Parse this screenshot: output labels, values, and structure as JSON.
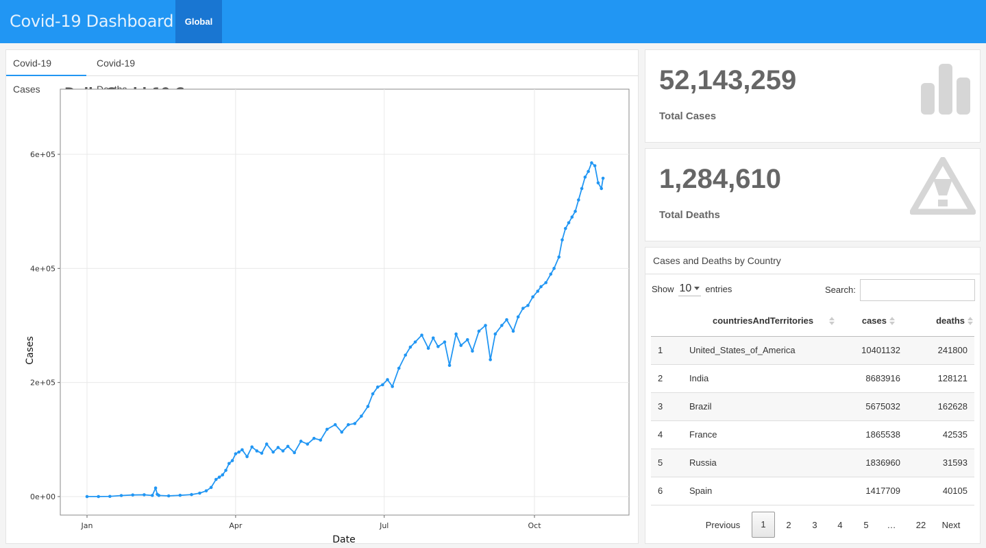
{
  "navbar": {
    "title": "Covid-19 Dashboard",
    "tab_global": "Global"
  },
  "tabs": [
    {
      "label": "Covid-19 Cases"
    },
    {
      "label": "Covid-19 Deaths"
    }
  ],
  "value_boxes": {
    "cases": {
      "value": "52,143,259",
      "label": "Total Cases",
      "icon": "bar-chart-icon"
    },
    "deaths": {
      "value": "1,284,610",
      "label": "Total Deaths",
      "icon": "warning-icon"
    }
  },
  "table_panel": {
    "title": "Cases and Deaths by Country",
    "show_label": "Show",
    "length_value": "10",
    "entries_label": "entries",
    "search_label": "Search:",
    "search_value": "",
    "columns": [
      "",
      "countriesAndTerritories",
      "cases",
      "deaths"
    ],
    "rows": [
      {
        "idx": "1",
        "country": "United_States_of_America",
        "cases": "10401132",
        "deaths": "241800"
      },
      {
        "idx": "2",
        "country": "India",
        "cases": "8683916",
        "deaths": "128121"
      },
      {
        "idx": "3",
        "country": "Brazil",
        "cases": "5675032",
        "deaths": "162628"
      },
      {
        "idx": "4",
        "country": "France",
        "cases": "1865538",
        "deaths": "42535"
      },
      {
        "idx": "5",
        "country": "Russia",
        "cases": "1836960",
        "deaths": "31593"
      },
      {
        "idx": "6",
        "country": "Spain",
        "cases": "1417709",
        "deaths": "40105"
      }
    ],
    "pagination": {
      "previous": "Previous",
      "pages": [
        "1",
        "2",
        "3",
        "4",
        "5",
        "…",
        "22"
      ],
      "current": "1",
      "next": "Next"
    }
  },
  "chart_data": {
    "type": "line",
    "title": "Daily Covid-19 Cases",
    "xlabel": "Date",
    "ylabel": "Cases",
    "x_ticks": [
      "Jan",
      "Apr",
      "Jul",
      "Oct"
    ],
    "y_ticks": [
      "0e+00",
      "2e+05",
      "4e+05",
      "6e+05"
    ],
    "ylim": [
      -15000,
      600000
    ],
    "grid": true,
    "line_color": "#2196f3",
    "series": [
      {
        "x": [
          "2020-01-01",
          "2020-01-08",
          "2020-01-15",
          "2020-01-22",
          "2020-01-29",
          "2020-02-05",
          "2020-02-10",
          "2020-02-12",
          "2020-02-13",
          "2020-02-14",
          "2020-02-20",
          "2020-02-27",
          "2020-03-05",
          "2020-03-10",
          "2020-03-14",
          "2020-03-17",
          "2020-03-20",
          "2020-03-22",
          "2020-03-24",
          "2020-03-26",
          "2020-03-28",
          "2020-03-30",
          "2020-04-01",
          "2020-04-03",
          "2020-04-05",
          "2020-04-08",
          "2020-04-11",
          "2020-04-14",
          "2020-04-17",
          "2020-04-20",
          "2020-04-24",
          "2020-04-27",
          "2020-04-30",
          "2020-05-03",
          "2020-05-07",
          "2020-05-11",
          "2020-05-15",
          "2020-05-19",
          "2020-05-23",
          "2020-05-27",
          "2020-06-01",
          "2020-06-05",
          "2020-06-09",
          "2020-06-13",
          "2020-06-17",
          "2020-06-21",
          "2020-06-24",
          "2020-06-27",
          "2020-06-30",
          "2020-07-03",
          "2020-07-06",
          "2020-07-10",
          "2020-07-14",
          "2020-07-17",
          "2020-07-20",
          "2020-07-24",
          "2020-07-28",
          "2020-07-31",
          "2020-08-03",
          "2020-08-07",
          "2020-08-10",
          "2020-08-14",
          "2020-08-17",
          "2020-08-21",
          "2020-08-24",
          "2020-08-28",
          "2020-09-01",
          "2020-09-04",
          "2020-09-07",
          "2020-09-11",
          "2020-09-14",
          "2020-09-18",
          "2020-09-21",
          "2020-09-24",
          "2020-09-27",
          "2020-09-30",
          "2020-10-03",
          "2020-10-05",
          "2020-10-08",
          "2020-10-11",
          "2020-10-13",
          "2020-10-16",
          "2020-10-18",
          "2020-10-20",
          "2020-10-22",
          "2020-10-24",
          "2020-10-26",
          "2020-10-28",
          "2020-10-30",
          "2020-11-01",
          "2020-11-03",
          "2020-11-05",
          "2020-11-07",
          "2020-11-09",
          "2020-11-11",
          "2020-11-12"
        ],
        "y": [
          0,
          0,
          300,
          1800,
          2800,
          3100,
          2000,
          15000,
          4000,
          2000,
          1200,
          2200,
          3500,
          6000,
          10000,
          16000,
          30000,
          34000,
          38000,
          46000,
          58000,
          63000,
          75000,
          78000,
          82000,
          70000,
          87000,
          80000,
          76000,
          92000,
          78000,
          86000,
          80000,
          88000,
          77000,
          97000,
          92000,
          102000,
          99000,
          118000,
          126000,
          113000,
          126000,
          128000,
          141000,
          158000,
          180000,
          192000,
          196000,
          205000,
          193000,
          225000,
          248000,
          262000,
          271000,
          283000,
          260000,
          278000,
          263000,
          271000,
          230000,
          285000,
          265000,
          275000,
          255000,
          290000,
          300000,
          240000,
          285000,
          300000,
          310000,
          290000,
          315000,
          330000,
          335000,
          350000,
          360000,
          368000,
          375000,
          390000,
          400000,
          420000,
          450000,
          470000,
          480000,
          490000,
          500000,
          520000,
          540000,
          560000,
          570000,
          585000,
          580000,
          550000,
          540000,
          558000
        ]
      }
    ]
  }
}
